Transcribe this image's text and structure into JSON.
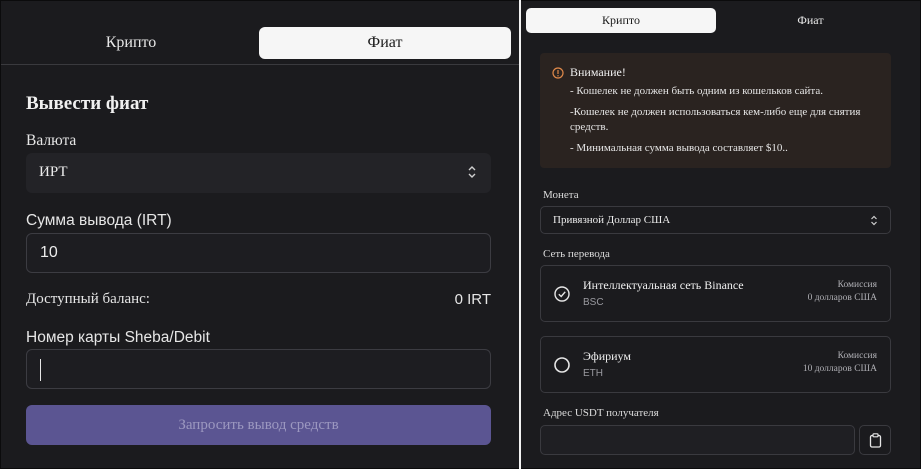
{
  "left": {
    "tabs": [
      "Крипто",
      "Фиат"
    ],
    "title": "Вывести фиат",
    "currency_label": "Валюта",
    "currency_value": "ИРТ",
    "amount_label": "Сумма вывода (IRT)",
    "amount_value": "10",
    "balance_label": "Доступный баланс:",
    "balance_value": "0 IRT",
    "card_label": "Номер карты Sheba/Debit",
    "card_value": "",
    "submit_label": "Запросить вывод средств"
  },
  "right": {
    "tabs": [
      "Крипто",
      "Фиат"
    ],
    "warning": {
      "title": "Внимание!",
      "lines": [
        "- Кошелек не должен быть одним из кошельков сайта.",
        "-Кошелек не должен использоваться кем-либо еще для снятия средств.",
        "- Минимальная сумма вывода составляет $10.."
      ]
    },
    "coin_label": "Монета",
    "coin_value": "Привязной Доллар США",
    "network_label": "Сеть перевода",
    "networks": [
      {
        "name": "Интеллектуальная сеть Binance",
        "code": "BSC",
        "fee_label": "Комиссия",
        "fee_value": "0 долларов США",
        "selected": true
      },
      {
        "name": "Эфириум",
        "code": "ETH",
        "fee_label": "Комиссия",
        "fee_value": "10 долларов США",
        "selected": false
      }
    ],
    "address_label": "Адрес USDT получателя",
    "address_value": ""
  },
  "icons": {
    "select_chevron": "chevron-up-down-icon",
    "warning": "info-circle-icon",
    "radio_selected": "check-circle-icon",
    "radio_empty": "empty-circle-icon",
    "paste": "clipboard-icon"
  },
  "colors": {
    "background": "#1b1b1e",
    "submit_button": "#5b5592",
    "warning_bg": "#2a2320",
    "warning_icon": "#e0894a",
    "active_tab": "#f6f6f6"
  }
}
